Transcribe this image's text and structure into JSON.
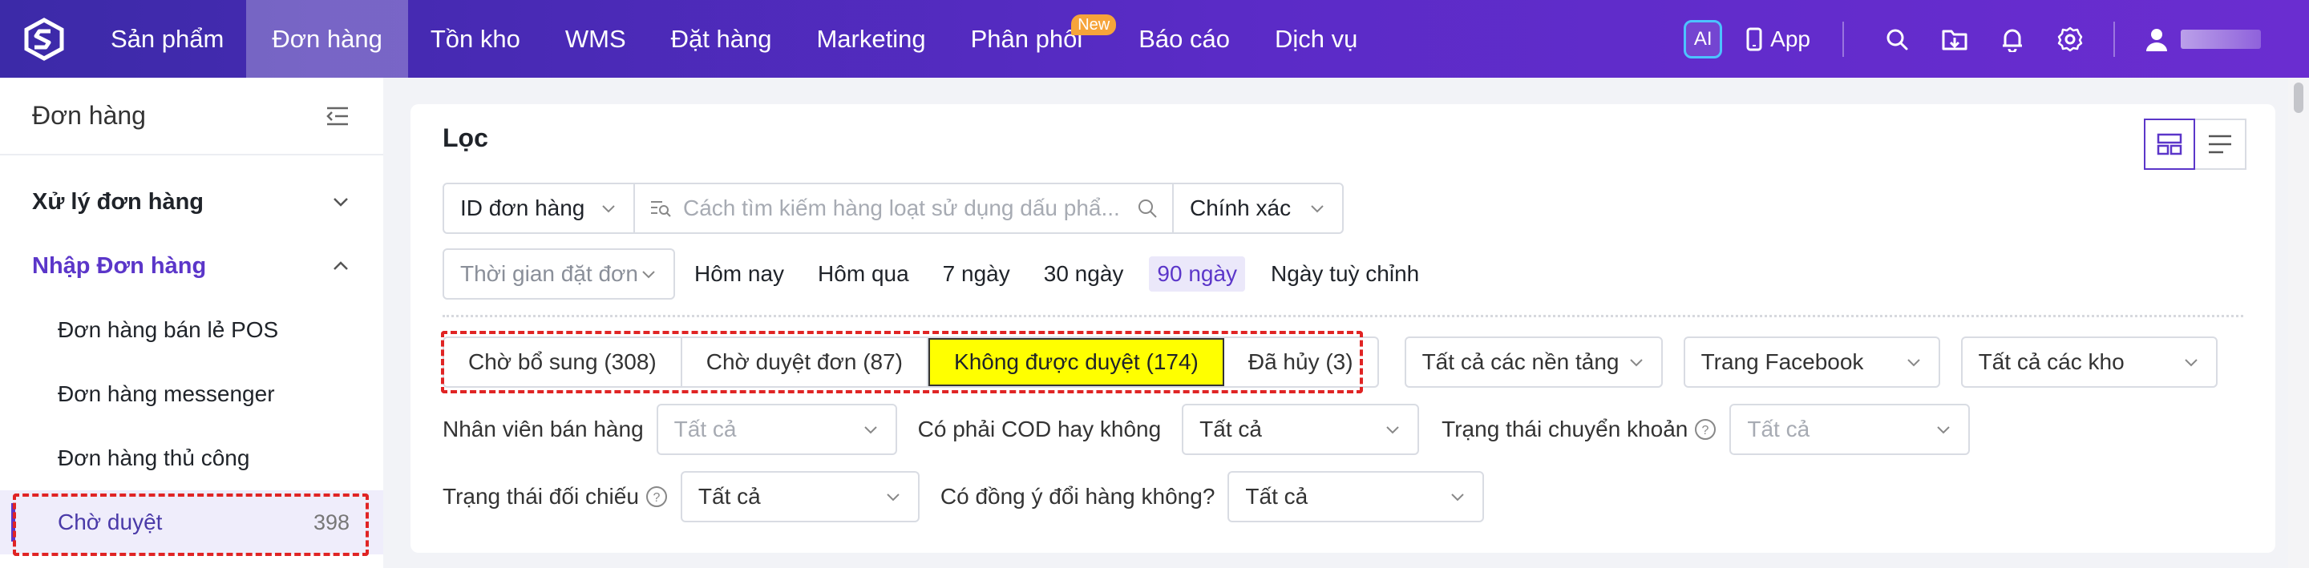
{
  "nav": {
    "items": [
      {
        "label": "Sản phẩm"
      },
      {
        "label": "Đơn hàng",
        "active": true
      },
      {
        "label": "Tồn kho"
      },
      {
        "label": "WMS"
      },
      {
        "label": "Đặt hàng"
      },
      {
        "label": "Marketing"
      },
      {
        "label": "Phân phối",
        "badge": "New"
      },
      {
        "label": "Báo cáo"
      },
      {
        "label": "Dịch vụ"
      }
    ],
    "ai_label": "AI",
    "app_label": "App"
  },
  "sidebar": {
    "title": "Đơn hàng",
    "groups": [
      {
        "label": "Xử lý đơn hàng",
        "expanded": false
      },
      {
        "label": "Nhập Đơn hàng",
        "expanded": true
      }
    ],
    "items": [
      {
        "label": "Đơn hàng bán lẻ POS"
      },
      {
        "label": "Đơn hàng messenger"
      },
      {
        "label": "Đơn hàng thủ công"
      },
      {
        "label": "Chờ duyệt",
        "count": "398",
        "active": true
      }
    ]
  },
  "filter": {
    "title": "Lọc",
    "search": {
      "field": "ID đơn hàng",
      "placeholder": "Cách tìm kiếm hàng loạt sử dụng dấu phẩ...",
      "match": "Chính xác"
    },
    "time": {
      "placeholder": "Thời gian đặt đơn",
      "options": [
        "Hôm nay",
        "Hôm qua",
        "7 ngày",
        "30 ngày",
        "90 ngày",
        "Ngày tuỳ chỉnh"
      ],
      "active": "90 ngày"
    },
    "status_tabs": [
      {
        "label": "Chờ bổ sung (308)"
      },
      {
        "label": "Chờ duyệt đơn (87)"
      },
      {
        "label": "Không được duyệt (174)",
        "selected": true
      },
      {
        "label": "Đã hủy (3)"
      }
    ],
    "platform": "Tất cả các nền tảng",
    "facebook_page": "Trang Facebook",
    "warehouse": "Tất cả các kho",
    "sales_staff": {
      "label": "Nhân viên bán hàng",
      "value": "Tất cả"
    },
    "cod": {
      "label": "Có phải COD hay không",
      "value": "Tất cả"
    },
    "transfer_status": {
      "label": "Trạng thái chuyển khoản",
      "value": "Tất cả"
    },
    "reconcile_status": {
      "label": "Trạng thái đối chiếu",
      "value": "Tất cả"
    },
    "exchange": {
      "label": "Có đồng ý đổi hàng không?",
      "value": "Tất cả"
    }
  },
  "colors": {
    "nav_gradient_start": "#3c2aa8",
    "nav_gradient_end": "#6a2dd0",
    "accent": "#5b36c9",
    "highlight_tab": "#ffff00",
    "annotation": "#e02424",
    "badge": "#f6a43a"
  }
}
